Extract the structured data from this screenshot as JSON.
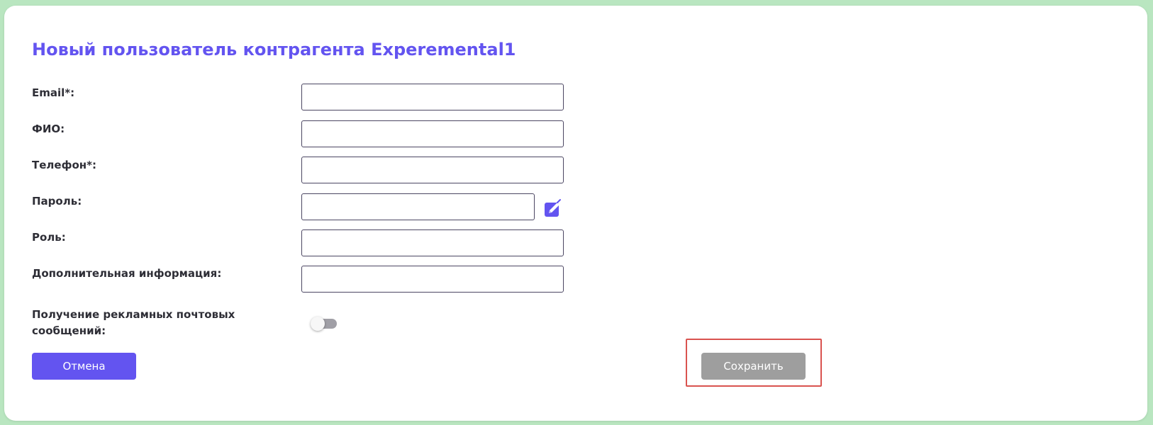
{
  "title": "Новый пользователь контрагента Experemental1",
  "fields": [
    {
      "label": "Email*:",
      "value": ""
    },
    {
      "label": "ФИО:",
      "value": ""
    },
    {
      "label": "Телефон*:",
      "value": ""
    },
    {
      "label": "Пароль:",
      "value": ""
    },
    {
      "label": "Роль:",
      "value": ""
    },
    {
      "label": "Дополнительная информация:",
      "value": ""
    }
  ],
  "newsletter": {
    "label_line1": "Получение рекламных почтовых",
    "label_line2": "сообщений:",
    "enabled": false
  },
  "buttons": {
    "cancel": "Отмена",
    "save": "Сохранить"
  },
  "colors": {
    "accent": "#6354f0",
    "disabled_button": "#9e9e9e",
    "highlight_border": "#d9534f",
    "background": "#b9e6c0"
  },
  "icons": {
    "password_edit": "edit-pencil-icon"
  }
}
